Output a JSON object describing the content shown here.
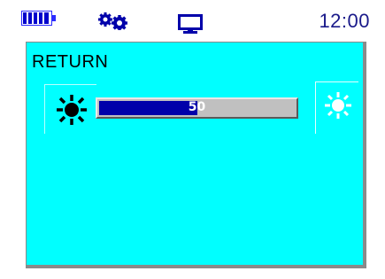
{
  "status_bar": {
    "icons": [
      "battery-icon",
      "settings-gears-icon",
      "monitor-icon"
    ],
    "time": "12:00"
  },
  "screen": {
    "background_color": "#00ffff",
    "title": "RETURN",
    "brightness": {
      "value_label": "50",
      "value_percent": 50,
      "fill_color": "#0000aa",
      "min_icon": "sun-dark-icon",
      "max_icon": "sun-bright-icon"
    }
  }
}
